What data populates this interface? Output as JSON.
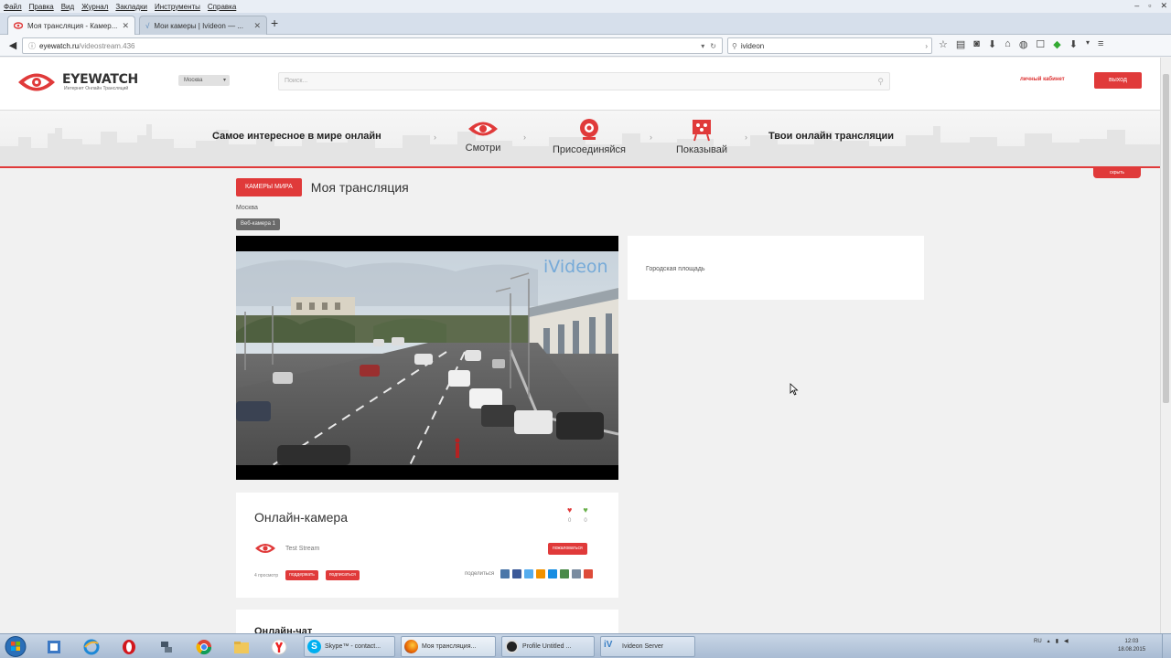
{
  "menubar": [
    "Файл",
    "Правка",
    "Вид",
    "Журнал",
    "Закладки",
    "Инструменты",
    "Справка"
  ],
  "browser": {
    "tabs": [
      {
        "label": "Моя трансляция - Камер..."
      },
      {
        "label": "Мои камеры | Ivideon — ..."
      }
    ],
    "url_host": "eyewatch.ru",
    "url_path": "/videostream.436",
    "search_value": "ivideon"
  },
  "site": {
    "logo": "EYEWATCH",
    "logo_sub": "Интернет Онлайн Трансляций",
    "region": "Москва",
    "search_placeholder": "Поиск...",
    "cabinet": "личный кабинет",
    "logout": "выход"
  },
  "banner": {
    "title": "Самое интересное в мире онлайн",
    "steps": [
      "Смотри",
      "Присоединяйся",
      "Показывай"
    ],
    "right": "Твои онлайн трансляции",
    "hide": "скрыть"
  },
  "content": {
    "cam_world": "камеры мира",
    "my_stream": "Моя трансляция",
    "city": "Москва",
    "webcam_chip": "Веб-камера 1",
    "watermark": "iVideon",
    "description": "Городская площадь",
    "card_title": "Онлайн-камера",
    "vote_up": "0",
    "vote_down": "0",
    "author": "Test Stream",
    "complain": "пожаловаться",
    "views": "4 просмотр",
    "support": "поддержать",
    "subscribe": "подписаться",
    "share": "поделиться",
    "chat_title": "Онлайн-чат"
  },
  "taskbar": {
    "apps": [
      "Skype™ - contact...",
      "Моя трансляция...",
      "Profile Untitled ...",
      "Ivideon Server"
    ],
    "lang": "RU",
    "time": "12:03",
    "date": "18.08.2015"
  },
  "colors": {
    "accent": "#e03a3a",
    "page_bg": "#f1f1f1"
  }
}
